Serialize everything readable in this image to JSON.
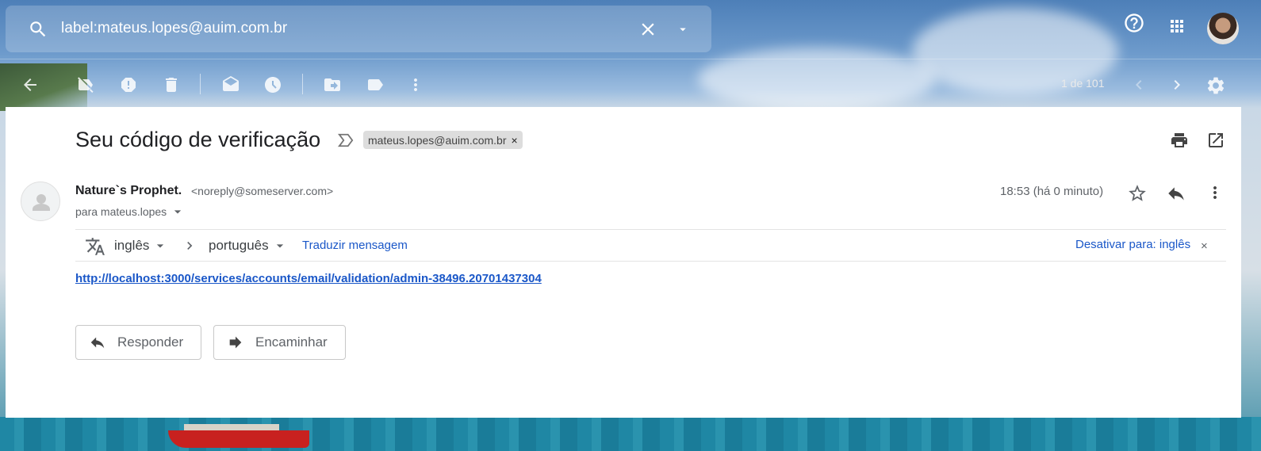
{
  "search": {
    "query": "label:mateus.lopes@auim.com.br"
  },
  "header": {
    "icons": [
      "search-icon",
      "clear-icon",
      "dropdown-icon",
      "help-icon",
      "apps-grid-icon"
    ]
  },
  "toolbar": {
    "page_count": "1 de 101",
    "icons": [
      "back-icon",
      "not-important-icon",
      "spam-icon",
      "trash-icon",
      "mark-read-icon",
      "snooze-icon",
      "move-to-icon",
      "label-icon",
      "more-icon",
      "newer-icon",
      "older-icon",
      "settings-icon"
    ]
  },
  "email": {
    "subject": "Seu código de verificação",
    "label_chip": "mateus.lopes@auim.com.br",
    "label_chip_close": "×",
    "sender_name": "Nature`s Prophet.",
    "sender_email": "<noreply@someserver.com>",
    "recipient": "para mateus.lopes",
    "time": "18:53 (há 0 minuto)",
    "body_link": "http://localhost:3000/services/accounts/email/validation/admin-38496.20701437304"
  },
  "translate": {
    "from_lang": "inglês",
    "to_lang": "português",
    "translate_link": "Traduzir mensagem",
    "disable_link": "Desativar para: inglês",
    "close": "×"
  },
  "actions": {
    "reply_label": "Responder",
    "forward_label": "Encaminhar"
  },
  "colors": {
    "link": "#1a57c8",
    "text": "#202124",
    "muted": "#5f6368"
  }
}
